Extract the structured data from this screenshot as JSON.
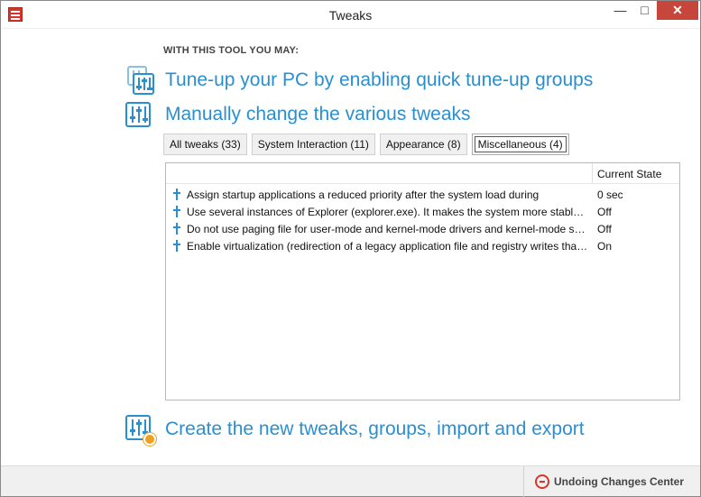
{
  "window": {
    "title": "Tweaks",
    "controls": {
      "minimize": "—",
      "maximize": "□",
      "close": "✕"
    }
  },
  "intro": {
    "subtitle": "WITH THIS TOOL YOU MAY:",
    "actions": [
      {
        "label": "Tune-up your PC by enabling quick tune-up groups",
        "icon": "tune-up-groups-icon"
      },
      {
        "label": "Manually change the various tweaks",
        "icon": "sliders-icon"
      }
    ]
  },
  "tabs": [
    {
      "label": "All tweaks (33)",
      "active": false
    },
    {
      "label": "System Interaction (11)",
      "active": false
    },
    {
      "label": "Appearance (8)",
      "active": false
    },
    {
      "label": "Miscellaneous (4)",
      "active": true
    }
  ],
  "list": {
    "columns": {
      "name": "",
      "state": "Current State"
    },
    "rows": [
      {
        "name": "Assign startup applications a reduced priority after the system load during",
        "state": "0 sec"
      },
      {
        "name": "Use several instances of Explorer (explorer.exe). It makes the system more stable, but",
        "state": "Off"
      },
      {
        "name": "Do not use paging file for user-mode and kernel-mode drivers and kernel-mode system",
        "state": "Off"
      },
      {
        "name": "Enable virtualization (redirection of a legacy application file and registry writes that fail",
        "state": "On"
      }
    ]
  },
  "create": {
    "label": "Create the new tweaks, groups, import and export",
    "icon": "sliders-gear-icon"
  },
  "footer": {
    "undo_label": "Undoing Changes Center",
    "undo_icon": "undo-circle-icon"
  },
  "colors": {
    "accent": "#2a8fd1",
    "close": "#c7463b",
    "app_icon": "#d9342b"
  }
}
